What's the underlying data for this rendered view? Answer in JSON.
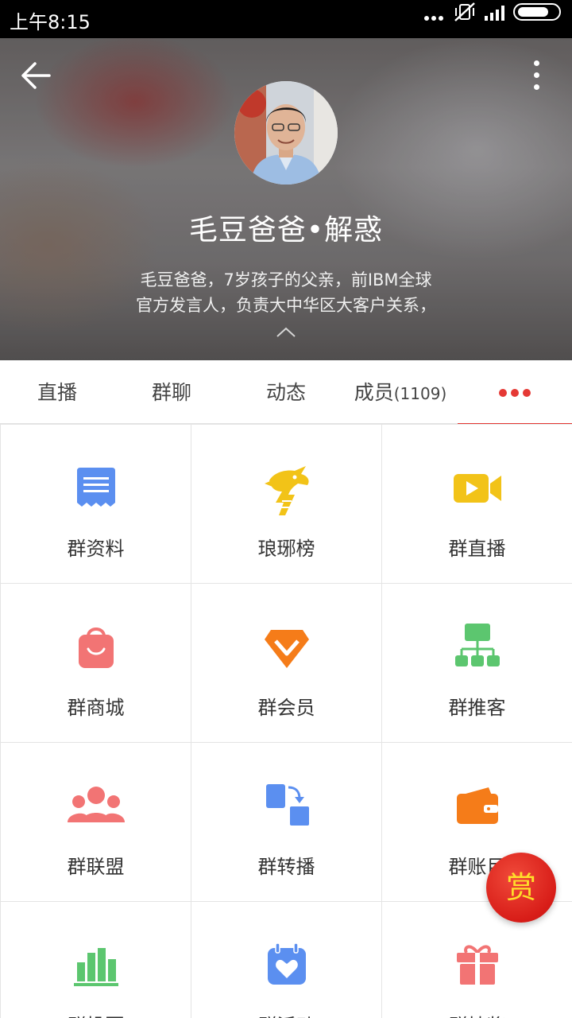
{
  "status_bar": {
    "time": "上午8:15"
  },
  "header": {
    "title": "毛豆爸爸•解惑",
    "description_line1": "毛豆爸爸，7岁孩子的父亲，前IBM全球",
    "description_line2": "官方发言人，负责大中华区大客户关系，"
  },
  "tabs": [
    {
      "label": "直播"
    },
    {
      "label": "群聊"
    },
    {
      "label": "动态"
    },
    {
      "label": "成员",
      "count": "(1109)"
    }
  ],
  "active_tab": "more",
  "grid": [
    {
      "label": "群资料",
      "icon": "document-icon",
      "color": "#5b8ff0"
    },
    {
      "label": "琅琊榜",
      "icon": "dragon-icon",
      "color": "#f2c318"
    },
    {
      "label": "群直播",
      "icon": "video-camera-icon",
      "color": "#f2c318"
    },
    {
      "label": "群商城",
      "icon": "shopping-bag-icon",
      "color": "#f27474"
    },
    {
      "label": "群会员",
      "icon": "vip-diamond-icon",
      "color": "#f57c19"
    },
    {
      "label": "群推客",
      "icon": "org-chart-icon",
      "color": "#5cc66f"
    },
    {
      "label": "群联盟",
      "icon": "people-group-icon",
      "color": "#f27474"
    },
    {
      "label": "群转播",
      "icon": "relay-icon",
      "color": "#5b8ff0"
    },
    {
      "label": "群账目",
      "icon": "wallet-icon",
      "color": "#f57c19"
    },
    {
      "label": "群投票",
      "icon": "bar-chart-icon",
      "color": "#5cc66f"
    },
    {
      "label": "群活动",
      "icon": "calendar-heart-icon",
      "color": "#5b8ff0"
    },
    {
      "label": "群抽奖",
      "icon": "gift-icon",
      "color": "#f27474"
    }
  ],
  "reward_button": {
    "label": "赏"
  },
  "colors": {
    "accent": "#e53935",
    "reward_text": "#ffde2a"
  }
}
